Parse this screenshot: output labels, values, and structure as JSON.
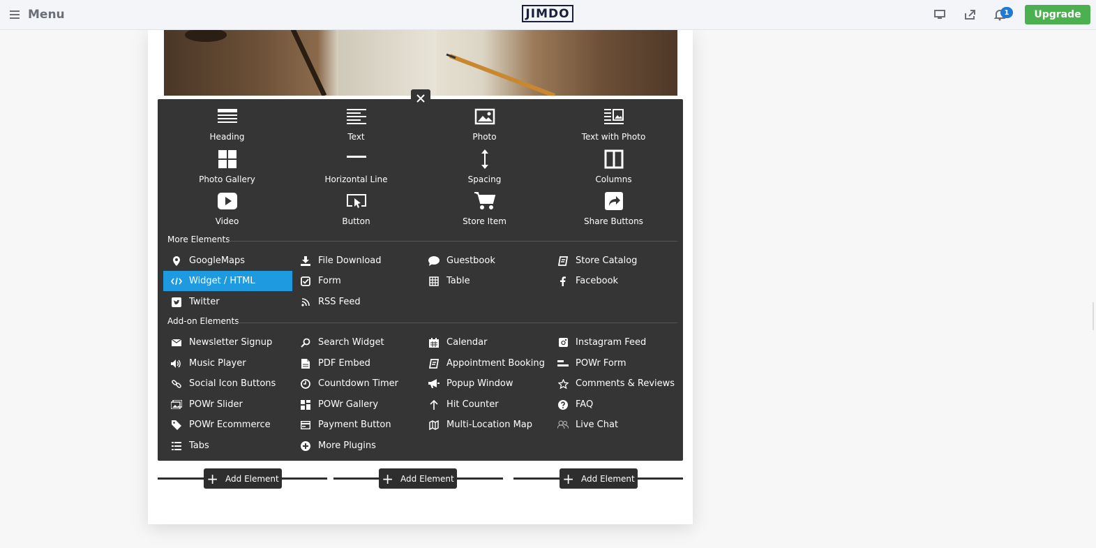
{
  "topbar": {
    "menu_label": "Menu",
    "logo_text": "JIMDO",
    "notification_count": "1",
    "upgrade_label": "Upgrade",
    "icons": [
      "menu-icon",
      "desktop-preview-icon",
      "share-icon",
      "bell-icon"
    ]
  },
  "panel": {
    "close_icon": "close-icon",
    "basic_elements": [
      {
        "label": "Heading",
        "icon": "heading-icon"
      },
      {
        "label": "Text",
        "icon": "text-icon"
      },
      {
        "label": "Photo",
        "icon": "photo-icon"
      },
      {
        "label": "Text with Photo",
        "icon": "text-with-photo-icon"
      },
      {
        "label": "Photo Gallery",
        "icon": "gallery-icon"
      },
      {
        "label": "Horizontal Line",
        "icon": "horizontal-line-icon"
      },
      {
        "label": "Spacing",
        "icon": "spacing-icon"
      },
      {
        "label": "Columns",
        "icon": "columns-icon"
      },
      {
        "label": "Video",
        "icon": "video-icon"
      },
      {
        "label": "Button",
        "icon": "button-icon"
      },
      {
        "label": "Store Item",
        "icon": "cart-icon"
      },
      {
        "label": "Share Buttons",
        "icon": "share-buttons-icon"
      }
    ],
    "more_title": "More Elements",
    "more_elements": [
      {
        "label": "GoogleMaps",
        "icon": "map-pin-icon"
      },
      {
        "label": "File Download",
        "icon": "download-icon"
      },
      {
        "label": "Guestbook",
        "icon": "speech-bubble-icon"
      },
      {
        "label": "Store Catalog",
        "icon": "catalog-icon"
      },
      {
        "label": "Widget / HTML",
        "icon": "code-icon",
        "active": true
      },
      {
        "label": "Form",
        "icon": "checkbox-icon"
      },
      {
        "label": "Table",
        "icon": "table-icon"
      },
      {
        "label": "Facebook",
        "icon": "facebook-icon"
      },
      {
        "label": "Twitter",
        "icon": "twitter-icon"
      },
      {
        "label": "RSS Feed",
        "icon": "rss-icon"
      }
    ],
    "addon_title": "Add-on Elements",
    "addon_elements": [
      {
        "label": "Newsletter Signup",
        "icon": "envelope-icon"
      },
      {
        "label": "Search Widget",
        "icon": "search-icon"
      },
      {
        "label": "Calendar",
        "icon": "calendar-icon"
      },
      {
        "label": "Instagram Feed",
        "icon": "instagram-icon"
      },
      {
        "label": "Music Player",
        "icon": "speaker-icon"
      },
      {
        "label": "PDF Embed",
        "icon": "pdf-icon"
      },
      {
        "label": "Appointment Booking",
        "icon": "booking-icon"
      },
      {
        "label": "POWr Form",
        "icon": "powr-form-icon"
      },
      {
        "label": "Social Icon Buttons",
        "icon": "link-icon"
      },
      {
        "label": "Countdown Timer",
        "icon": "clock-icon"
      },
      {
        "label": "Popup Window",
        "icon": "megaphone-icon"
      },
      {
        "label": "Comments & Reviews",
        "icon": "star-icon"
      },
      {
        "label": "POWr Slider",
        "icon": "slider-icon"
      },
      {
        "label": "POWr Gallery",
        "icon": "grid-icon"
      },
      {
        "label": "Hit Counter",
        "icon": "arrow-up-icon"
      },
      {
        "label": "FAQ",
        "icon": "question-icon"
      },
      {
        "label": "POWr Ecommerce",
        "icon": "tag-icon"
      },
      {
        "label": "Payment Button",
        "icon": "payment-icon"
      },
      {
        "label": "Multi-Location Map",
        "icon": "map-icon"
      },
      {
        "label": "Live Chat",
        "icon": "chat-users-icon"
      },
      {
        "label": "Tabs",
        "icon": "list-icon"
      },
      {
        "label": "More Plugins",
        "icon": "plus-circle-icon"
      }
    ]
  },
  "add_element_label": "Add Element",
  "add_element_buttons": [
    "Add Element",
    "Add Element",
    "Add Element"
  ]
}
